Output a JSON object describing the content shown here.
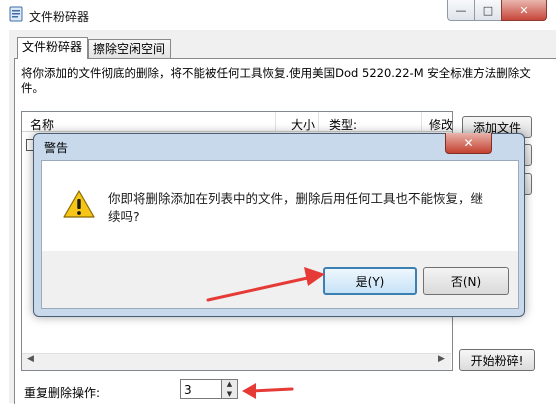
{
  "window": {
    "title": "文件粉碎器",
    "minimize_glyph": "—",
    "maximize_glyph": "□",
    "close_glyph": "✕"
  },
  "tabs": [
    {
      "label": "文件粉碎器",
      "active": true
    },
    {
      "label": "擦除空闲空间",
      "active": false
    }
  ],
  "description": "将你添加的文件彻底的删除，将不能被任何工具恢复.使用美国Dod 5220.22-M 安全标准方法删除文件。",
  "file_list": {
    "columns": [
      "名称",
      "大小",
      "类型:",
      "修改"
    ]
  },
  "side_buttons": {
    "add_file": "添加文件",
    "start": "开始粉碎!"
  },
  "repeat": {
    "label": "重复删除操作:",
    "value": "3",
    "up_glyph": "▲",
    "down_glyph": "▼"
  },
  "dialog": {
    "title": "警告",
    "close_glyph": "✕",
    "message": "你即将删除添加在列表中的文件，删除后用任何工具也不能恢复，继续吗?",
    "yes": "是(Y)",
    "no": "否(N)",
    "icon": "warning-icon"
  },
  "colors": {
    "annotation_arrow": "#e53a36",
    "dialog_frame": "#c7d9ea",
    "close_button": "#c7463a"
  }
}
